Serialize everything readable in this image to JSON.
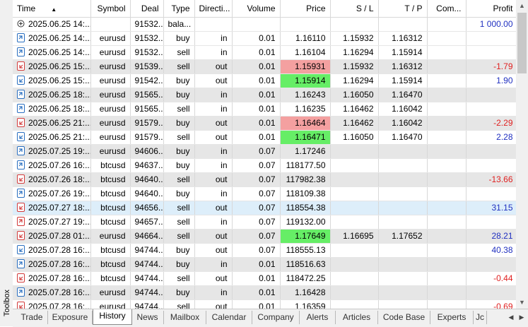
{
  "toolbox_label": "Toolbox",
  "columns": [
    "Time",
    "Symbol",
    "Deal",
    "Type",
    "Directi...",
    "Volume",
    "Price",
    "S / L",
    "T / P",
    "Com...",
    "Profit"
  ],
  "rows": [
    {
      "icon": "balance",
      "time": "2025.06.25 14:...",
      "symbol": "",
      "deal": "91532...",
      "type": "bala...",
      "direction": "",
      "volume": "",
      "price": "",
      "sl": "",
      "tp": "",
      "comment": "",
      "profit": "1 000.00",
      "profit_sign": "pos",
      "price_hl": "",
      "style": "white"
    },
    {
      "icon": "in",
      "time": "2025.06.25 14:...",
      "symbol": "eurusd",
      "deal": "91532...",
      "type": "buy",
      "direction": "in",
      "volume": "0.01",
      "price": "1.16110",
      "sl": "1.15932",
      "tp": "1.16312",
      "comment": "",
      "profit": "",
      "profit_sign": "",
      "price_hl": "",
      "style": "white"
    },
    {
      "icon": "in",
      "time": "2025.06.25 14:...",
      "symbol": "eurusd",
      "deal": "91532...",
      "type": "sell",
      "direction": "in",
      "volume": "0.01",
      "price": "1.16104",
      "sl": "1.16294",
      "tp": "1.15914",
      "comment": "",
      "profit": "",
      "profit_sign": "",
      "price_hl": "",
      "style": "white"
    },
    {
      "icon": "out-loss",
      "time": "2025.06.25 15:...",
      "symbol": "eurusd",
      "deal": "91539...",
      "type": "sell",
      "direction": "out",
      "volume": "0.01",
      "price": "1.15931",
      "sl": "1.15932",
      "tp": "1.16312",
      "comment": "",
      "profit": "-1.79",
      "profit_sign": "neg",
      "price_hl": "red",
      "style": "alt"
    },
    {
      "icon": "out-profit",
      "time": "2025.06.25 15:...",
      "symbol": "eurusd",
      "deal": "91542...",
      "type": "buy",
      "direction": "out",
      "volume": "0.01",
      "price": "1.15914",
      "sl": "1.16294",
      "tp": "1.15914",
      "comment": "",
      "profit": "1.90",
      "profit_sign": "pos",
      "price_hl": "green",
      "style": "white"
    },
    {
      "icon": "in",
      "time": "2025.06.25 18:...",
      "symbol": "eurusd",
      "deal": "91565...",
      "type": "buy",
      "direction": "in",
      "volume": "0.01",
      "price": "1.16243",
      "sl": "1.16050",
      "tp": "1.16470",
      "comment": "",
      "profit": "",
      "profit_sign": "",
      "price_hl": "",
      "style": "alt"
    },
    {
      "icon": "in",
      "time": "2025.06.25 18:...",
      "symbol": "eurusd",
      "deal": "91565...",
      "type": "sell",
      "direction": "in",
      "volume": "0.01",
      "price": "1.16235",
      "sl": "1.16462",
      "tp": "1.16042",
      "comment": "",
      "profit": "",
      "profit_sign": "",
      "price_hl": "",
      "style": "white"
    },
    {
      "icon": "out-loss",
      "time": "2025.06.25 21:...",
      "symbol": "eurusd",
      "deal": "91579...",
      "type": "buy",
      "direction": "out",
      "volume": "0.01",
      "price": "1.16464",
      "sl": "1.16462",
      "tp": "1.16042",
      "comment": "",
      "profit": "-2.29",
      "profit_sign": "neg",
      "price_hl": "red",
      "style": "alt"
    },
    {
      "icon": "out-profit",
      "time": "2025.06.25 21:...",
      "symbol": "eurusd",
      "deal": "91579...",
      "type": "sell",
      "direction": "out",
      "volume": "0.01",
      "price": "1.16471",
      "sl": "1.16050",
      "tp": "1.16470",
      "comment": "",
      "profit": "2.28",
      "profit_sign": "pos",
      "price_hl": "green",
      "style": "white"
    },
    {
      "icon": "in",
      "time": "2025.07.25 19:...",
      "symbol": "eurusd",
      "deal": "94606...",
      "type": "buy",
      "direction": "in",
      "volume": "0.07",
      "price": "1.17246",
      "sl": "",
      "tp": "",
      "comment": "",
      "profit": "",
      "profit_sign": "",
      "price_hl": "",
      "style": "alt"
    },
    {
      "icon": "in",
      "time": "2025.07.26 16:...",
      "symbol": "btcusd",
      "deal": "94637...",
      "type": "buy",
      "direction": "in",
      "volume": "0.07",
      "price": "118177.50",
      "sl": "",
      "tp": "",
      "comment": "",
      "profit": "",
      "profit_sign": "",
      "price_hl": "",
      "style": "white"
    },
    {
      "icon": "out-loss",
      "time": "2025.07.26 18:...",
      "symbol": "btcusd",
      "deal": "94640...",
      "type": "sell",
      "direction": "out",
      "volume": "0.07",
      "price": "117982.38",
      "sl": "",
      "tp": "",
      "comment": "",
      "profit": "-13.66",
      "profit_sign": "neg",
      "price_hl": "",
      "style": "alt"
    },
    {
      "icon": "in",
      "time": "2025.07.26 19:...",
      "symbol": "btcusd",
      "deal": "94640...",
      "type": "buy",
      "direction": "in",
      "volume": "0.07",
      "price": "118109.38",
      "sl": "",
      "tp": "",
      "comment": "",
      "profit": "",
      "profit_sign": "",
      "price_hl": "",
      "style": "white"
    },
    {
      "icon": "out-loss",
      "time": "2025.07.27 18:...",
      "symbol": "btcusd",
      "deal": "94656...",
      "type": "sell",
      "direction": "out",
      "volume": "0.07",
      "price": "118554.38",
      "sl": "",
      "tp": "",
      "comment": "",
      "profit": "31.15",
      "profit_sign": "pos",
      "price_hl": "",
      "style": "sel"
    },
    {
      "icon": "in-sell",
      "time": "2025.07.27 19:...",
      "symbol": "btcusd",
      "deal": "94657...",
      "type": "sell",
      "direction": "in",
      "volume": "0.07",
      "price": "119132.00",
      "sl": "",
      "tp": "",
      "comment": "",
      "profit": "",
      "profit_sign": "",
      "price_hl": "",
      "style": "white"
    },
    {
      "icon": "out-loss",
      "time": "2025.07.28 01:...",
      "symbol": "eurusd",
      "deal": "94664...",
      "type": "sell",
      "direction": "out",
      "volume": "0.07",
      "price": "1.17649",
      "sl": "1.16695",
      "tp": "1.17652",
      "comment": "",
      "profit": "28.21",
      "profit_sign": "pos",
      "price_hl": "green",
      "style": "alt"
    },
    {
      "icon": "out-profit",
      "time": "2025.07.28 16:...",
      "symbol": "btcusd",
      "deal": "94744...",
      "type": "buy",
      "direction": "out",
      "volume": "0.07",
      "price": "118555.13",
      "sl": "",
      "tp": "",
      "comment": "",
      "profit": "40.38",
      "profit_sign": "pos",
      "price_hl": "",
      "style": "white"
    },
    {
      "icon": "in",
      "time": "2025.07.28 16:...",
      "symbol": "btcusd",
      "deal": "94744...",
      "type": "buy",
      "direction": "in",
      "volume": "0.01",
      "price": "118516.63",
      "sl": "",
      "tp": "",
      "comment": "",
      "profit": "",
      "profit_sign": "",
      "price_hl": "",
      "style": "alt"
    },
    {
      "icon": "out-loss",
      "time": "2025.07.28 16:...",
      "symbol": "btcusd",
      "deal": "94744...",
      "type": "sell",
      "direction": "out",
      "volume": "0.01",
      "price": "118472.25",
      "sl": "",
      "tp": "",
      "comment": "",
      "profit": "-0.44",
      "profit_sign": "neg",
      "price_hl": "",
      "style": "white"
    },
    {
      "icon": "in",
      "time": "2025.07.28 16:...",
      "symbol": "eurusd",
      "deal": "94744...",
      "type": "buy",
      "direction": "in",
      "volume": "0.01",
      "price": "1.16428",
      "sl": "",
      "tp": "",
      "comment": "",
      "profit": "",
      "profit_sign": "",
      "price_hl": "",
      "style": "alt"
    },
    {
      "icon": "out-loss",
      "time": "2025.07.28 16:...",
      "symbol": "eurusd",
      "deal": "94744...",
      "type": "sell",
      "direction": "out",
      "volume": "0.01",
      "price": "1.16359",
      "sl": "",
      "tp": "",
      "comment": "",
      "profit": "-0.69",
      "profit_sign": "neg",
      "price_hl": "",
      "style": "white"
    }
  ],
  "tabs": [
    {
      "label": "Trade",
      "active": false
    },
    {
      "label": "Exposure",
      "active": false
    },
    {
      "label": "History",
      "active": true
    },
    {
      "label": "News",
      "active": false
    },
    {
      "label": "Mailbox",
      "active": false
    },
    {
      "label": "Calendar",
      "active": false
    },
    {
      "label": "Company",
      "active": false
    },
    {
      "label": "Alerts",
      "active": false
    },
    {
      "label": "Articles",
      "active": false
    },
    {
      "label": "Code Base",
      "active": false
    },
    {
      "label": "Experts",
      "active": false
    },
    {
      "label": "Jc",
      "active": false
    }
  ],
  "colors": {
    "buy_icon": "#2a6fc0",
    "sell_icon": "#d23b3b",
    "loss_price": "#f4a0a0",
    "profit_price": "#66ee66",
    "neg_profit": "#e02020",
    "pos_profit": "#2030c0"
  }
}
